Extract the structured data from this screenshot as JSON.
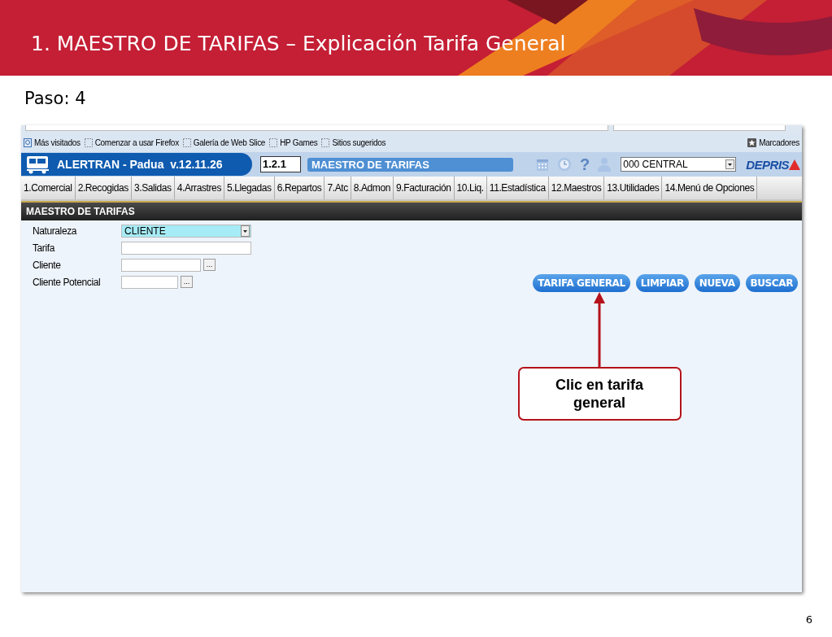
{
  "slide": {
    "title": "1. MAESTRO DE TARIFAS – Explicación Tarifa General",
    "step": "Paso: 4",
    "page_number": "6"
  },
  "browser": {
    "bookmarks": [
      {
        "label": "Más visitados",
        "kind": "page"
      },
      {
        "label": "Comenzar a usar Firefox",
        "kind": "dotted"
      },
      {
        "label": "Galería de Web Slice",
        "kind": "dotted"
      },
      {
        "label": "HP Games",
        "kind": "dotted"
      },
      {
        "label": "Sitios sugeridos",
        "kind": "dotted"
      }
    ],
    "bookmarks_menu": "Marcadores"
  },
  "app": {
    "name": "ALERTRAN - Padua  v.12.11.26",
    "code": "1.2.1",
    "screen_title": "MAESTRO DE TARIFAS",
    "help": "?",
    "office": "000 CENTRAL",
    "logo": "DEPRIS",
    "tabs": [
      "1.Comercial",
      "2.Recogidas",
      "3.Salidas",
      "4.Arrastres",
      "5.Llegadas",
      "6.Repartos",
      "7.Atc",
      "8.Admon",
      "9.Facturación",
      "10.Liq.",
      "11.Estadística",
      "12.Maestros",
      "13.Utilidades",
      "14.Menú de Opciones"
    ],
    "section": "MAESTRO DE TARIFAS",
    "fields": [
      {
        "label": "Naturaleza",
        "kind": "select",
        "value": "CLIENTE",
        "focused": true
      },
      {
        "label": "Tarifa",
        "kind": "text",
        "focused": false
      },
      {
        "label": "Cliente",
        "kind": "lookup",
        "focused": false,
        "lookup": "..."
      },
      {
        "label": "Cliente Potencial",
        "kind": "lookup-short",
        "focused": false,
        "lookup": "..."
      }
    ],
    "buttons": [
      "TARIFA GENERAL",
      "LIMPIAR",
      "NUEVA",
      "BUSCAR"
    ]
  },
  "callout": {
    "text": "Clic en tarifa general"
  }
}
